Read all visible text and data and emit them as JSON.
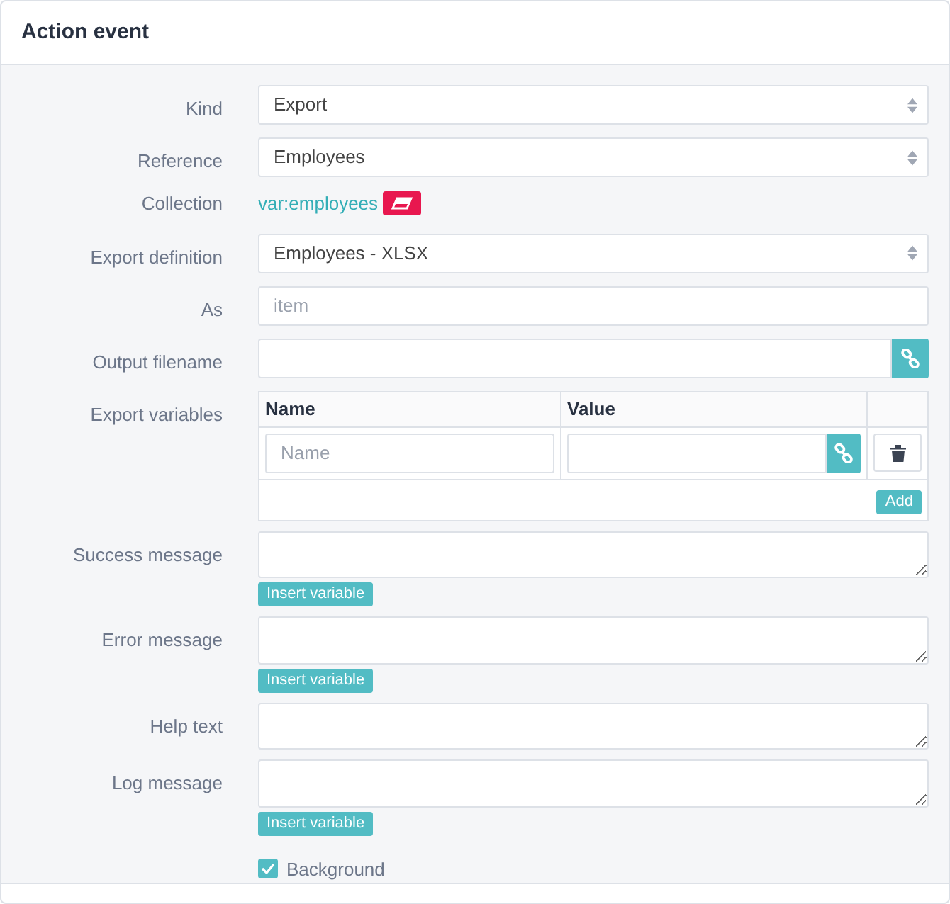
{
  "title": "Action event",
  "fields": [
    {
      "kind": "select",
      "label": "Kind",
      "value": "Export"
    },
    {
      "kind": "select",
      "label": "Reference",
      "value": "Employees"
    },
    {
      "kind": "reference",
      "label": "Collection",
      "value": "var:employees"
    },
    {
      "kind": "select",
      "label": "Export definition",
      "value": "Employees - XLSX"
    },
    {
      "kind": "text",
      "label": "As",
      "placeholder": "item"
    },
    {
      "kind": "linked",
      "label": "Output filename"
    },
    {
      "kind": "table",
      "label": "Export variables",
      "columns": [
        "Name",
        "Value"
      ],
      "rows": [
        {
          "name_placeholder": "Name"
        }
      ],
      "add_button": "Add"
    },
    {
      "kind": "textarea",
      "label": "Success message",
      "insert_button": "Insert variable"
    },
    {
      "kind": "textarea",
      "label": "Error message",
      "insert_button": "Insert variable"
    },
    {
      "kind": "textarea",
      "label": "Help text"
    },
    {
      "kind": "textarea",
      "label": "Log message",
      "insert_button": "Insert variable"
    },
    {
      "kind": "checkbox",
      "label": "Background",
      "checked": true
    }
  ]
}
